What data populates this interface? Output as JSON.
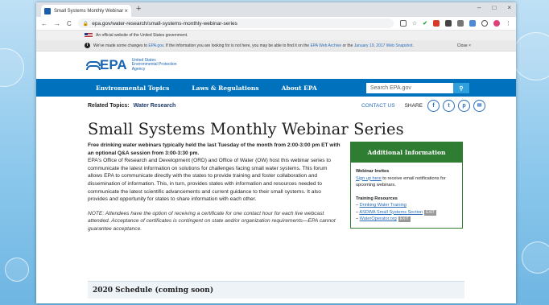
{
  "browser": {
    "tab_title": "Small Systems Monthly Webinar",
    "tab_close": "×",
    "new_tab": "+",
    "url": "epa.gov/water-research/small-systems-monthly-webinar-series",
    "window_controls": [
      "–",
      "□",
      "×"
    ]
  },
  "gov_banner": {
    "text": "An official website of the United States government."
  },
  "notice": {
    "text_pre": "We've made some changes to ",
    "link1": "EPA.gov",
    "text_mid": ". If the information you are looking for is not here, you may be able to find it on the ",
    "link2": "EPA Web Archive",
    "text_mid2": " or the ",
    "link3": "January 19, 2017 Web Snapshot",
    "text_end": ".",
    "close_label": "Close ×"
  },
  "header": {
    "logo_text": "EPA",
    "logo_sub": [
      "United States",
      "Environmental Protection",
      "Agency"
    ]
  },
  "nav": {
    "items": [
      "Environmental Topics",
      "Laws & Regulations",
      "About EPA"
    ],
    "search_placeholder": "Search EPA.gov"
  },
  "related": {
    "label": "Related Topics:",
    "link": "Water Research",
    "contact": "CONTACT US",
    "share": "SHARE"
  },
  "page": {
    "title": "Small Systems Monthly Webinar Series",
    "lead": "Free drinking water webinars typically held the last Tuesday of the month from 2:00-3:00 pm ET with an optional Q&A session from 3:00-3:30 pm.",
    "body": "EPA's Office of Research and Development (ORD) and Office of Water (OW) host this webinar series to communicate the latest information on solutions for challenges facing small water systems. This forum allows EPA to communicate directly with the states to provide training and foster collaboration and dissemination of information. This, in turn, provides states with information and resources needed to communicate the latest scientific advancements and current guidance to their small systems. It also provides and opportunity for states to share information with each other.",
    "note": "NOTE: Attendees have the option of receiving a certificate for one contact hour for each live webcast attended. Acceptance of certificates is contingent on state and/or organization requirements—EPA cannot guarantee acceptance.",
    "schedule_heading": "2020 Schedule (coming soon)"
  },
  "sidebar": {
    "title": "Additional Information",
    "invites_heading": "Webinar Invites",
    "signup_link": "Sign up here",
    "signup_text": " to receive email notifications for upcoming webinars.",
    "resources_heading": "Training Resources",
    "resources": [
      {
        "label": "Drinking Water Training",
        "exit": ""
      },
      {
        "label": "ASDWA Small Systems Section",
        "exit": "EXIT"
      },
      {
        "label": "WaterOperator.org",
        "exit": "EXIT"
      }
    ]
  },
  "colors": {
    "nav_blue": "#0071bc",
    "sidebar_green": "#2e7d32",
    "link_blue": "#2a6ebb"
  }
}
